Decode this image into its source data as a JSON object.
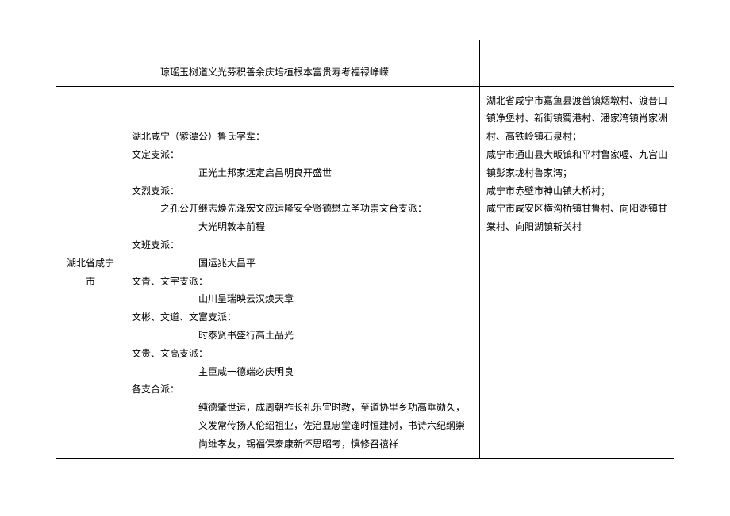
{
  "top": {
    "line": "琼瑶玉树道义光芬积善余庆培植根本富贵寿考福禄峥嵘"
  },
  "region": "湖北省咸宁市",
  "main": {
    "title": "湖北咸宁（紫潭公）鲁氏字辈：",
    "branch1_name": "文定支派：",
    "branch1_text": "正光土邦家远定启昌明良开盛世",
    "branch2_name": "文烈支派：",
    "branch2_text1": "之孔公开继志焕先泽宏文应运隆安全贤德懋立圣功崇文台支派：",
    "branch2_text2": "大光明敦本前程",
    "branch3_name": "文班支派：",
    "branch3_text": "国运兆大昌平",
    "branch4_name": "文青、文宇支派：",
    "branch4_text": "山川呈瑞映云汉焕天章",
    "branch5_name": "文彬、文道、文富支派：",
    "branch5_text": "时泰贤书盛行高土品光",
    "branch6_name": "文贵、文高支派：",
    "branch6_text": "主臣咸一德端必庆明良",
    "branch7_name": "各支合派：",
    "branch7_text": "纯德肇世运，成周朝祚长礼乐宜时教，至道协里乡功高垂勋久，义发常传扬人伦绍祖业，佐治显忠堂逢时恒建树，书诗六纪纲崇尚维孝友，锡福保泰康新怀思昭考，慎修召禧祥"
  },
  "places": {
    "line1": "湖北省咸宁市嘉鱼县渡普镇烟墩村、渡普口镇净堡村、新街镇蜀港村、潘家湾镇肖家洲村、高铁岭镇石泉村；",
    "line2": "咸宁市通山县大畈镇和平村鲁家喔、九宫山镇彭家垅村鲁家湾；",
    "line3": "咸宁市赤壁市神山镇大桥村；",
    "line4": "咸宁市咸安区横沟桥镇甘鲁村、向阳湖镇甘棠村、向阳湖镇斩关村"
  }
}
